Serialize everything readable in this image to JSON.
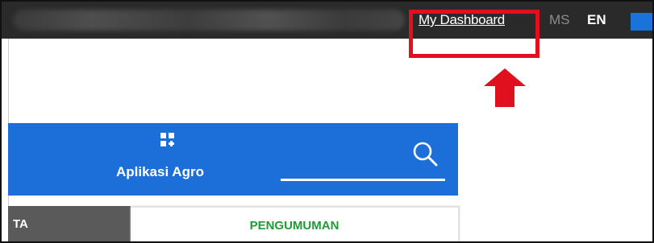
{
  "topbar": {
    "dashboard_link": "My Dashboard",
    "languages": [
      "MS",
      "EN"
    ]
  },
  "bluebar": {
    "app_label": "Aplikasi Agro"
  },
  "tabs": [
    {
      "label": "TA"
    },
    {
      "label": "PENGUMUMAN"
    }
  ],
  "colors": {
    "topbar": "#2a2a2a",
    "accent_blue": "#1c6fd8",
    "highlight_red": "#e0101e",
    "tab_green_text": "#1e9b34"
  }
}
